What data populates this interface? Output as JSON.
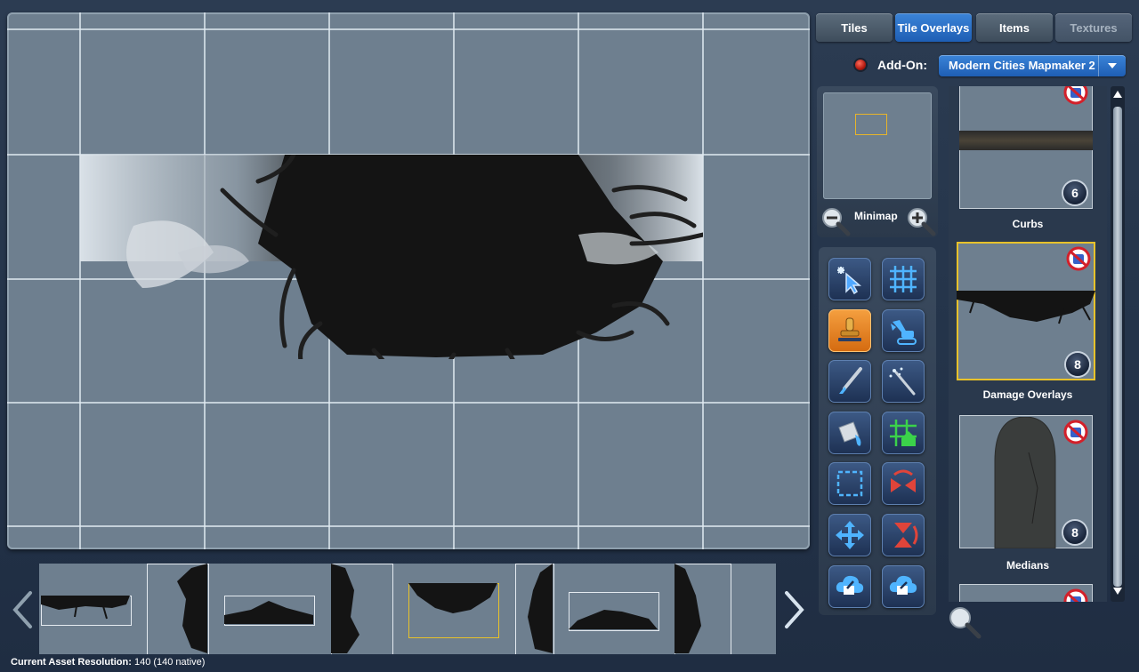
{
  "tabs": [
    {
      "label": "Tiles",
      "state": "normal"
    },
    {
      "label": "Tile Overlays",
      "state": "active"
    },
    {
      "label": "Items",
      "state": "normal"
    },
    {
      "label": "Textures",
      "state": "disabled"
    }
  ],
  "addon": {
    "label": "Add-On:",
    "selected": "Modern Cities Mapmaker 2",
    "indicator_color": "#d0281a"
  },
  "minimap": {
    "label": "Minimap",
    "zoom_out_icon": "zoom-out-icon",
    "zoom_in_icon": "zoom-in-icon"
  },
  "tools": [
    {
      "name": "select-tool",
      "icon": "cursor-sparkle-icon"
    },
    {
      "name": "grid-tool",
      "icon": "grid-icon"
    },
    {
      "name": "stamp-tool",
      "icon": "stamp-icon",
      "active": true
    },
    {
      "name": "excavator-tool",
      "icon": "excavator-icon"
    },
    {
      "name": "brush-tool",
      "icon": "paintbrush-icon"
    },
    {
      "name": "magic-wand-tool",
      "icon": "magic-wand-icon"
    },
    {
      "name": "fill-tool",
      "icon": "paint-bucket-icon"
    },
    {
      "name": "tile-grid-tool",
      "icon": "tile-grid-house-icon"
    },
    {
      "name": "marquee-tool",
      "icon": "marquee-icon"
    },
    {
      "name": "flip-horizontal-tool",
      "icon": "flip-horizontal-icon"
    },
    {
      "name": "move-tool",
      "icon": "move-arrows-icon"
    },
    {
      "name": "flip-vertical-tool",
      "icon": "flip-vertical-icon"
    },
    {
      "name": "import-tool",
      "icon": "import-icon"
    },
    {
      "name": "export-tool",
      "icon": "export-icon"
    }
  ],
  "assets": [
    {
      "name": "Curbs",
      "count": "6",
      "selected": false
    },
    {
      "name": "Damage Overlays",
      "count": "8",
      "selected": true
    },
    {
      "name": "Medians",
      "count": "8",
      "selected": false
    }
  ],
  "strip": {
    "prev_icon": "chevron-left-icon",
    "next_icon": "chevron-right-icon",
    "selected_index": 4
  },
  "status": {
    "resolution_label": "Current Asset Resolution:",
    "resolution_value": "140 (140 native)"
  },
  "search_icon": "search-icon",
  "colors": {
    "accent": "#2a72cc",
    "highlight": "#e8c22a",
    "canvas": "#6e7f8f",
    "background": "#24344a"
  }
}
